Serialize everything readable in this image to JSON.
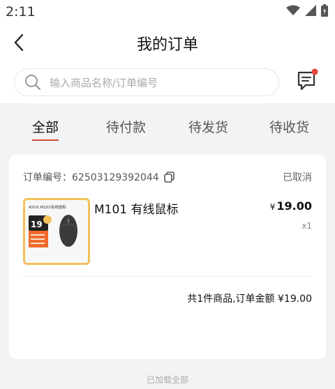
{
  "status_bar": {
    "time": "2:11"
  },
  "header": {
    "title": "我的订单"
  },
  "search": {
    "placeholder": "输入商品名称/订单编号"
  },
  "tabs": [
    {
      "label": "全部",
      "active": true
    },
    {
      "label": "待付款",
      "active": false
    },
    {
      "label": "待发货",
      "active": false
    },
    {
      "label": "待收货",
      "active": false
    }
  ],
  "order": {
    "number_label": "订单编号：62503129392044",
    "status": "已取消",
    "product_name": "M101 有线鼠标",
    "price_symbol": "¥",
    "price": "19.00",
    "quantity": "x1",
    "summary": "共1件商品,订单金额 ¥19.00",
    "thumbnail_text": {
      "headline": "A5US M101有线鼠标",
      "price": "19",
      "badge": "限时特惠"
    }
  },
  "footer": {
    "text": "已加载全部"
  },
  "colors": {
    "accent": "#d94a34",
    "thumb_border": "#f3c05a",
    "thumb_orange": "#f06a2a"
  }
}
